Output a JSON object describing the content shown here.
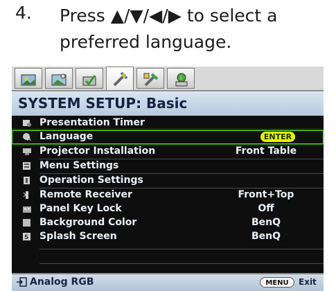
{
  "instruction": {
    "number": "4.",
    "line1": "Press ▲/▼/◀/▶ to select a",
    "line2": "preferred language."
  },
  "osd": {
    "tabs": [
      {
        "icon": "picture-icon"
      },
      {
        "icon": "picture-advanced-icon"
      },
      {
        "icon": "display-icon"
      },
      {
        "icon": "system-setup-basic-icon",
        "active": true
      },
      {
        "icon": "system-setup-advanced-icon"
      },
      {
        "icon": "information-icon"
      }
    ],
    "header": "SYSTEM SETUP: Basic",
    "items": [
      {
        "label": "Presentation Timer",
        "value": ""
      },
      {
        "label": "Language",
        "value": "",
        "selected": true
      },
      {
        "label": "Projector Installation",
        "value": "Front Table"
      },
      {
        "label": "Menu Settings",
        "value": ""
      },
      {
        "label": "Operation Settings",
        "value": ""
      },
      {
        "label": "Remote Receiver",
        "value": "Front+Top"
      },
      {
        "label": "Panel Key Lock",
        "value": "Off"
      },
      {
        "label": "Background Color",
        "value": "BenQ"
      },
      {
        "label": "Splash Screen",
        "value": "BenQ"
      }
    ],
    "enter_label": "ENTER",
    "footer": {
      "source": "Analog RGB",
      "menu_label": "MENU",
      "exit_label": "Exit"
    }
  },
  "colors": {
    "highlight": "#55e11f",
    "enter_button": "#e6f400",
    "panel_bg": "#0e0e0e",
    "header_bg": "#c6d5e7"
  }
}
